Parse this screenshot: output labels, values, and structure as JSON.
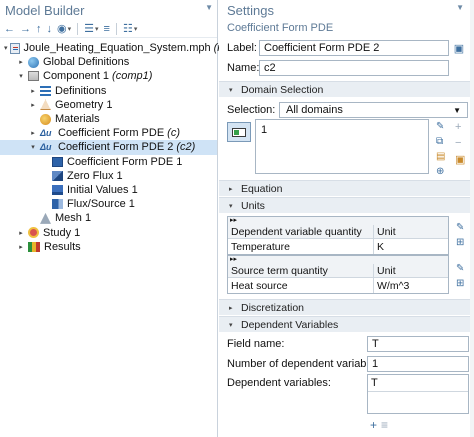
{
  "model_builder": {
    "title": "Model Builder",
    "pin_icon": "pin-down-icon",
    "toolbar": [
      "arrow-left-icon",
      "arrow-right-icon",
      "arrow-up-icon",
      "arrow-down-icon",
      "show-more-icon",
      "collapse-all-icon",
      "expand-all-icon",
      "model-tree-options-icon"
    ],
    "tree": [
      {
        "name": "root",
        "indent": 0,
        "expander": "▾",
        "icon": "i-file",
        "label": "Joule_Heating_Equation_System.mph",
        "tag": "(root)"
      },
      {
        "name": "global-definitions",
        "indent": 1,
        "expander": "▸",
        "icon": "i-globe",
        "label": "Global Definitions",
        "tag": ""
      },
      {
        "name": "component-1",
        "indent": 1,
        "expander": "▾",
        "icon": "i-comp",
        "label": "Component 1",
        "tag": "(comp1)"
      },
      {
        "name": "definitions",
        "indent": 2,
        "expander": "▸",
        "icon": "i-defs",
        "label": "Definitions",
        "tag": ""
      },
      {
        "name": "geometry-1",
        "indent": 2,
        "expander": "▸",
        "icon": "i-geom",
        "label": "Geometry 1",
        "tag": ""
      },
      {
        "name": "materials",
        "indent": 2,
        "expander": "",
        "icon": "i-mat",
        "label": "Materials",
        "tag": ""
      },
      {
        "name": "coefficient-form-pde",
        "indent": 2,
        "expander": "▸",
        "icon": "i-pde",
        "icon_text": "Δu",
        "label": "Coefficient Form PDE",
        "tag": "(c)"
      },
      {
        "name": "coefficient-form-pde-2",
        "indent": 2,
        "expander": "▾",
        "icon": "i-pde",
        "icon_text": "Δu",
        "label": "Coefficient Form PDE 2",
        "tag": "(c2)",
        "selected": true
      },
      {
        "name": "coefficient-form-pde-1",
        "indent": 3,
        "expander": "",
        "icon": "i-sub",
        "label": "Coefficient Form PDE 1",
        "tag": ""
      },
      {
        "name": "zero-flux-1",
        "indent": 3,
        "expander": "",
        "icon": "i-zero",
        "label": "Zero Flux 1",
        "tag": ""
      },
      {
        "name": "initial-values-1",
        "indent": 3,
        "expander": "",
        "icon": "i-init",
        "label": "Initial Values 1",
        "tag": ""
      },
      {
        "name": "flux-source-1",
        "indent": 3,
        "expander": "",
        "icon": "i-flux",
        "label": "Flux/Source 1",
        "tag": ""
      },
      {
        "name": "mesh-1",
        "indent": 2,
        "expander": "",
        "icon": "i-mesh",
        "label": "Mesh 1",
        "tag": ""
      },
      {
        "name": "study-1",
        "indent": 1,
        "expander": "▸",
        "icon": "i-study",
        "label": "Study 1",
        "tag": ""
      },
      {
        "name": "results",
        "indent": 1,
        "expander": "▸",
        "icon": "i-res",
        "label": "Results",
        "tag": ""
      }
    ]
  },
  "settings": {
    "title": "Settings",
    "subtitle": "Coefficient Form PDE",
    "label_caption": "Label:",
    "label_value": "Coefficient Form PDE 2",
    "name_caption": "Name:",
    "name_value": "c2",
    "sections": {
      "domain_selection": "Domain Selection",
      "equation": "Equation",
      "units": "Units",
      "discretization": "Discretization",
      "dependent_variables": "Dependent Variables"
    },
    "selection_caption": "Selection:",
    "selection_value": "All domains",
    "domain_list": [
      "1"
    ],
    "units_table_1": {
      "marker": "▸▸",
      "col1": "Dependent variable quantity",
      "col2": "Unit",
      "rows": [
        [
          "Temperature",
          "K"
        ]
      ]
    },
    "units_table_2": {
      "marker": "▸▸",
      "col1": "Source term quantity",
      "col2": "Unit",
      "rows": [
        [
          "Heat source",
          "W/m^3"
        ]
      ]
    },
    "field_name_caption": "Field name:",
    "field_name_value": "T",
    "num_dep_caption": "Number of dependent variables:",
    "num_dep_value": "1",
    "dep_vars_caption": "Dependent variables:",
    "dep_vars_values": [
      "T"
    ],
    "add_icon": "plus-icon",
    "table_edit_icon": "table-edit-icon"
  },
  "colors": {
    "accent": "#5e7a96",
    "selected_row": "#cfe3f6",
    "section_bg": "#e9eef3"
  }
}
